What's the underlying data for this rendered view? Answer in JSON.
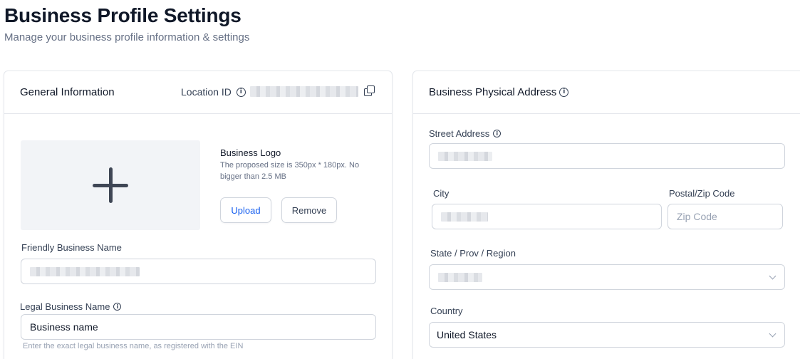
{
  "header": {
    "title": "Business Profile Settings",
    "subtitle": "Manage your business profile information & settings"
  },
  "general": {
    "title": "General Information",
    "location_label": "Location ID",
    "logo": {
      "title": "Business Logo",
      "description": "The proposed size is 350px * 180px. No bigger than 2.5 MB",
      "upload_label": "Upload",
      "remove_label": "Remove"
    },
    "friendly_name": {
      "label": "Friendly Business Name"
    },
    "legal_name": {
      "label": "Legal Business Name",
      "value": "Business name",
      "hint": "Enter the exact legal business name, as registered with the EIN"
    }
  },
  "address": {
    "title": "Business Physical Address",
    "street": {
      "label": "Street Address"
    },
    "city": {
      "label": "City"
    },
    "postal": {
      "label": "Postal/Zip Code",
      "placeholder": "Zip Code"
    },
    "state": {
      "label": "State / Prov / Region"
    },
    "country": {
      "label": "Country",
      "value": "United States"
    }
  },
  "icons": {
    "info": "info-icon",
    "copy": "copy-icon",
    "add": "plus-icon",
    "dropdown": "chevron-down-icon"
  },
  "colors": {
    "upload_text": "#155eef",
    "border": "#e4e7ec",
    "placeholder": "#98a2b3"
  }
}
